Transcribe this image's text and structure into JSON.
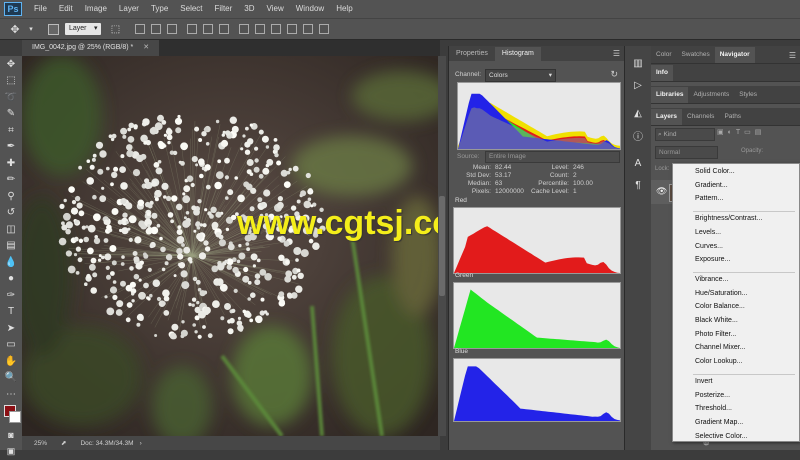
{
  "app": {
    "logo": "Ps"
  },
  "menubar": {
    "items": [
      "File",
      "Edit",
      "Image",
      "Layer",
      "Type",
      "Select",
      "Filter",
      "3D",
      "View",
      "Window",
      "Help"
    ]
  },
  "options": {
    "auto_select_value": "Layer"
  },
  "document": {
    "tab_title": "IMG_0042.jpg @ 25% (RGB/8) *",
    "zoom": "25%",
    "doc_size": "Doc: 34.3M/34.3M"
  },
  "watermark": "www.cgtsj.com",
  "histogram_panel": {
    "tabs": [
      "Properties",
      "Histogram"
    ],
    "channel_label": "Channel:",
    "channel_value": "Colors",
    "source_label": "Source:",
    "source_value": "Entire Image",
    "stats_left": [
      {
        "label": "Mean:",
        "value": "82.44"
      },
      {
        "label": "Std Dev:",
        "value": "53.17"
      },
      {
        "label": "Median:",
        "value": "63"
      },
      {
        "label": "Pixels:",
        "value": "12000000"
      }
    ],
    "stats_right": [
      {
        "label": "Level:",
        "value": "246"
      },
      {
        "label": "Count:",
        "value": "2"
      },
      {
        "label": "Percentile:",
        "value": "100.00"
      },
      {
        "label": "Cache Level:",
        "value": "1"
      }
    ],
    "channels": [
      "Red",
      "Green",
      "Blue"
    ],
    "colors": {
      "red": "#e21b1b",
      "green": "#22e622",
      "blue": "#2323e8",
      "yellow": "#f0e000"
    }
  },
  "right_panel": {
    "top_tabs": [
      "Color",
      "Swatches",
      "Navigator"
    ],
    "info_tab": "Info",
    "lib_tabs": [
      "Libraries",
      "Adjustments",
      "Styles"
    ],
    "layer_tabs": [
      "Layers",
      "Channels",
      "Paths"
    ],
    "kind_filter": "Kind",
    "blend_mode": "Normal",
    "opacity_label": "Opacity:",
    "lock_label": "Lock:"
  },
  "adjustment_menu": {
    "groups": [
      [
        "Solid Color...",
        "Gradient...",
        "Pattern..."
      ],
      [
        "Brightness/Contrast...",
        "Levels...",
        "Curves...",
        "Exposure..."
      ],
      [
        "Vibrance...",
        "Hue/Saturation...",
        "Color Balance...",
        "Black  White...",
        "Photo Filter...",
        "Channel Mixer...",
        "Color Lookup..."
      ],
      [
        "Invert",
        "Posterize...",
        "Threshold...",
        "Gradient Map...",
        "Selective Color..."
      ]
    ]
  }
}
